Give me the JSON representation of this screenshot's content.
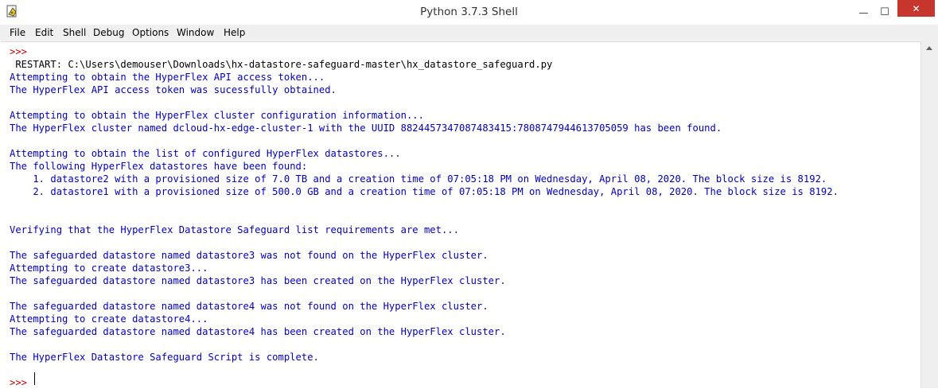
{
  "window": {
    "title": "Python 3.7.3 Shell",
    "icon": "python-idle-icon",
    "controls": {
      "minimize": "—",
      "maximize": "☐",
      "close": "✕"
    }
  },
  "menu": [
    "File",
    "Edit",
    "Shell",
    "Debug",
    "Options",
    "Window",
    "Help"
  ],
  "shell": {
    "lines": [
      {
        "text": ">>>",
        "style": "prompt"
      },
      {
        "text": " RESTART: C:\\Users\\demouser\\Downloads\\hx-datastore-safeguard-master\\hx_datastore_safeguard.py",
        "style": "blk"
      },
      {
        "text": "Attempting to obtain the HyperFlex API access token...",
        "style": "out"
      },
      {
        "text": "The HyperFlex API access token was sucessfully obtained.",
        "style": "out"
      },
      {
        "text": "",
        "style": "out"
      },
      {
        "text": "Attempting to obtain the HyperFlex cluster configuration information...",
        "style": "out"
      },
      {
        "text": "The HyperFlex cluster named dcloud-hx-edge-cluster-1 with the UUID 8824457347087483415:7808747944613705059 has been found.",
        "style": "out"
      },
      {
        "text": "",
        "style": "out"
      },
      {
        "text": "Attempting to obtain the list of configured HyperFlex datastores...",
        "style": "out"
      },
      {
        "text": "The following HyperFlex datastores have been found:",
        "style": "out"
      },
      {
        "text": "    1. datastore2 with a provisioned size of 7.0 TB and a creation time of 07:05:18 PM on Wednesday, April 08, 2020. The block size is 8192.",
        "style": "out"
      },
      {
        "text": "    2. datastore1 with a provisioned size of 500.0 GB and a creation time of 07:05:18 PM on Wednesday, April 08, 2020. The block size is 8192.",
        "style": "out"
      },
      {
        "text": "",
        "style": "out"
      },
      {
        "text": "",
        "style": "out"
      },
      {
        "text": "Verifying that the HyperFlex Datastore Safeguard list requirements are met...",
        "style": "out"
      },
      {
        "text": "",
        "style": "out"
      },
      {
        "text": "The safeguarded datastore named datastore3 was not found on the HyperFlex cluster.",
        "style": "out"
      },
      {
        "text": "Attempting to create datastore3...",
        "style": "out"
      },
      {
        "text": "The safeguarded datastore named datastore3 has been created on the HyperFlex cluster.",
        "style": "out"
      },
      {
        "text": "",
        "style": "out"
      },
      {
        "text": "The safeguarded datastore named datastore4 was not found on the HyperFlex cluster.",
        "style": "out"
      },
      {
        "text": "Attempting to create datastore4...",
        "style": "out"
      },
      {
        "text": "The safeguarded datastore named datastore4 has been created on the HyperFlex cluster.",
        "style": "out"
      },
      {
        "text": "",
        "style": "out"
      },
      {
        "text": "The HyperFlex Datastore Safeguard Script is complete.",
        "style": "out"
      },
      {
        "text": "",
        "style": "out"
      },
      {
        "text": ">>>",
        "style": "prompt"
      }
    ]
  }
}
